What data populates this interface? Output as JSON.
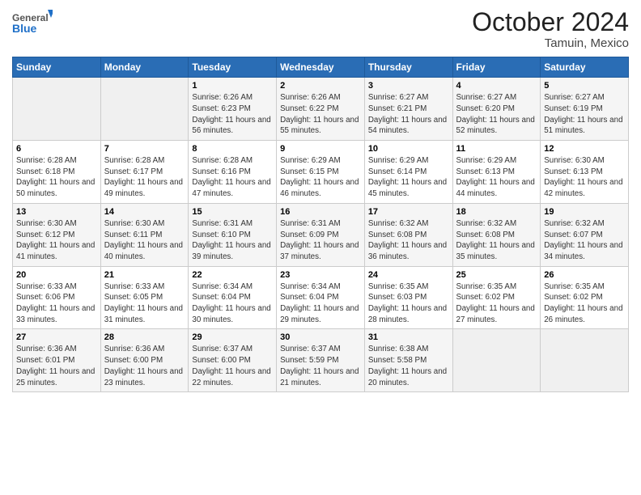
{
  "header": {
    "logo_general": "General",
    "logo_blue": "Blue",
    "month": "October 2024",
    "location": "Tamuin, Mexico"
  },
  "weekdays": [
    "Sunday",
    "Monday",
    "Tuesday",
    "Wednesday",
    "Thursday",
    "Friday",
    "Saturday"
  ],
  "weeks": [
    [
      {
        "day": "",
        "sunrise": "",
        "sunset": "",
        "daylight": "",
        "empty": true
      },
      {
        "day": "",
        "sunrise": "",
        "sunset": "",
        "daylight": "",
        "empty": true
      },
      {
        "day": "1",
        "sunrise": "Sunrise: 6:26 AM",
        "sunset": "Sunset: 6:23 PM",
        "daylight": "Daylight: 11 hours and 56 minutes."
      },
      {
        "day": "2",
        "sunrise": "Sunrise: 6:26 AM",
        "sunset": "Sunset: 6:22 PM",
        "daylight": "Daylight: 11 hours and 55 minutes."
      },
      {
        "day": "3",
        "sunrise": "Sunrise: 6:27 AM",
        "sunset": "Sunset: 6:21 PM",
        "daylight": "Daylight: 11 hours and 54 minutes."
      },
      {
        "day": "4",
        "sunrise": "Sunrise: 6:27 AM",
        "sunset": "Sunset: 6:20 PM",
        "daylight": "Daylight: 11 hours and 52 minutes."
      },
      {
        "day": "5",
        "sunrise": "Sunrise: 6:27 AM",
        "sunset": "Sunset: 6:19 PM",
        "daylight": "Daylight: 11 hours and 51 minutes."
      }
    ],
    [
      {
        "day": "6",
        "sunrise": "Sunrise: 6:28 AM",
        "sunset": "Sunset: 6:18 PM",
        "daylight": "Daylight: 11 hours and 50 minutes."
      },
      {
        "day": "7",
        "sunrise": "Sunrise: 6:28 AM",
        "sunset": "Sunset: 6:17 PM",
        "daylight": "Daylight: 11 hours and 49 minutes."
      },
      {
        "day": "8",
        "sunrise": "Sunrise: 6:28 AM",
        "sunset": "Sunset: 6:16 PM",
        "daylight": "Daylight: 11 hours and 47 minutes."
      },
      {
        "day": "9",
        "sunrise": "Sunrise: 6:29 AM",
        "sunset": "Sunset: 6:15 PM",
        "daylight": "Daylight: 11 hours and 46 minutes."
      },
      {
        "day": "10",
        "sunrise": "Sunrise: 6:29 AM",
        "sunset": "Sunset: 6:14 PM",
        "daylight": "Daylight: 11 hours and 45 minutes."
      },
      {
        "day": "11",
        "sunrise": "Sunrise: 6:29 AM",
        "sunset": "Sunset: 6:13 PM",
        "daylight": "Daylight: 11 hours and 44 minutes."
      },
      {
        "day": "12",
        "sunrise": "Sunrise: 6:30 AM",
        "sunset": "Sunset: 6:13 PM",
        "daylight": "Daylight: 11 hours and 42 minutes."
      }
    ],
    [
      {
        "day": "13",
        "sunrise": "Sunrise: 6:30 AM",
        "sunset": "Sunset: 6:12 PM",
        "daylight": "Daylight: 11 hours and 41 minutes."
      },
      {
        "day": "14",
        "sunrise": "Sunrise: 6:30 AM",
        "sunset": "Sunset: 6:11 PM",
        "daylight": "Daylight: 11 hours and 40 minutes."
      },
      {
        "day": "15",
        "sunrise": "Sunrise: 6:31 AM",
        "sunset": "Sunset: 6:10 PM",
        "daylight": "Daylight: 11 hours and 39 minutes."
      },
      {
        "day": "16",
        "sunrise": "Sunrise: 6:31 AM",
        "sunset": "Sunset: 6:09 PM",
        "daylight": "Daylight: 11 hours and 37 minutes."
      },
      {
        "day": "17",
        "sunrise": "Sunrise: 6:32 AM",
        "sunset": "Sunset: 6:08 PM",
        "daylight": "Daylight: 11 hours and 36 minutes."
      },
      {
        "day": "18",
        "sunrise": "Sunrise: 6:32 AM",
        "sunset": "Sunset: 6:08 PM",
        "daylight": "Daylight: 11 hours and 35 minutes."
      },
      {
        "day": "19",
        "sunrise": "Sunrise: 6:32 AM",
        "sunset": "Sunset: 6:07 PM",
        "daylight": "Daylight: 11 hours and 34 minutes."
      }
    ],
    [
      {
        "day": "20",
        "sunrise": "Sunrise: 6:33 AM",
        "sunset": "Sunset: 6:06 PM",
        "daylight": "Daylight: 11 hours and 33 minutes."
      },
      {
        "day": "21",
        "sunrise": "Sunrise: 6:33 AM",
        "sunset": "Sunset: 6:05 PM",
        "daylight": "Daylight: 11 hours and 31 minutes."
      },
      {
        "day": "22",
        "sunrise": "Sunrise: 6:34 AM",
        "sunset": "Sunset: 6:04 PM",
        "daylight": "Daylight: 11 hours and 30 minutes."
      },
      {
        "day": "23",
        "sunrise": "Sunrise: 6:34 AM",
        "sunset": "Sunset: 6:04 PM",
        "daylight": "Daylight: 11 hours and 29 minutes."
      },
      {
        "day": "24",
        "sunrise": "Sunrise: 6:35 AM",
        "sunset": "Sunset: 6:03 PM",
        "daylight": "Daylight: 11 hours and 28 minutes."
      },
      {
        "day": "25",
        "sunrise": "Sunrise: 6:35 AM",
        "sunset": "Sunset: 6:02 PM",
        "daylight": "Daylight: 11 hours and 27 minutes."
      },
      {
        "day": "26",
        "sunrise": "Sunrise: 6:35 AM",
        "sunset": "Sunset: 6:02 PM",
        "daylight": "Daylight: 11 hours and 26 minutes."
      }
    ],
    [
      {
        "day": "27",
        "sunrise": "Sunrise: 6:36 AM",
        "sunset": "Sunset: 6:01 PM",
        "daylight": "Daylight: 11 hours and 25 minutes."
      },
      {
        "day": "28",
        "sunrise": "Sunrise: 6:36 AM",
        "sunset": "Sunset: 6:00 PM",
        "daylight": "Daylight: 11 hours and 23 minutes."
      },
      {
        "day": "29",
        "sunrise": "Sunrise: 6:37 AM",
        "sunset": "Sunset: 6:00 PM",
        "daylight": "Daylight: 11 hours and 22 minutes."
      },
      {
        "day": "30",
        "sunrise": "Sunrise: 6:37 AM",
        "sunset": "Sunset: 5:59 PM",
        "daylight": "Daylight: 11 hours and 21 minutes."
      },
      {
        "day": "31",
        "sunrise": "Sunrise: 6:38 AM",
        "sunset": "Sunset: 5:58 PM",
        "daylight": "Daylight: 11 hours and 20 minutes."
      },
      {
        "day": "",
        "sunrise": "",
        "sunset": "",
        "daylight": "",
        "empty": true
      },
      {
        "day": "",
        "sunrise": "",
        "sunset": "",
        "daylight": "",
        "empty": true
      }
    ]
  ]
}
